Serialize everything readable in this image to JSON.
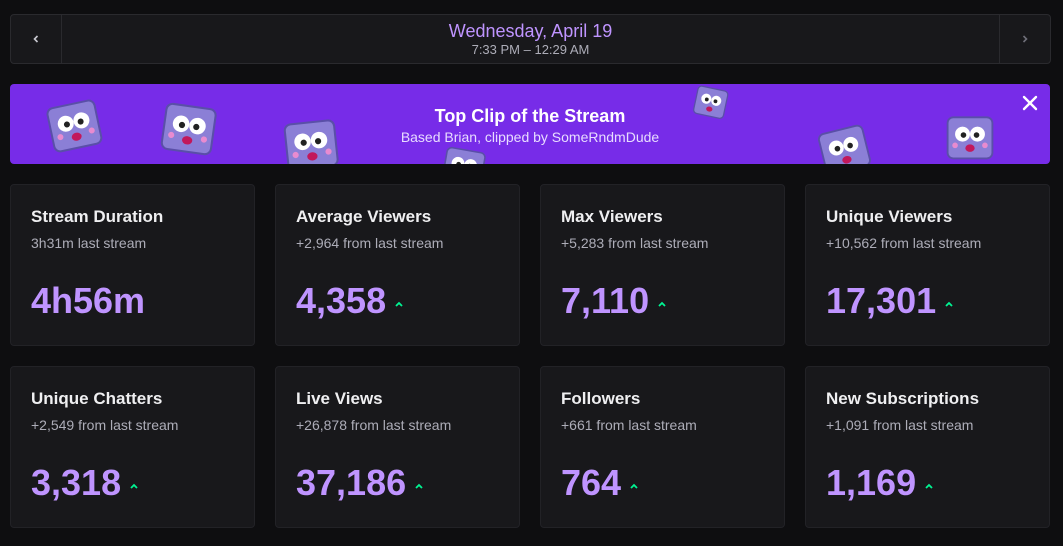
{
  "header": {
    "date": "Wednesday, April 19",
    "time_range": "7:33 PM – 12:29 AM"
  },
  "clip_banner": {
    "title": "Top Clip of the Stream",
    "subtitle": "Based Brian, clipped by SomeRndmDude"
  },
  "stats": [
    {
      "title": "Stream Duration",
      "sub": "3h31m last stream",
      "value": "4h56m",
      "trend": "none"
    },
    {
      "title": "Average Viewers",
      "sub": "+2,964 from last stream",
      "value": "4,358",
      "trend": "up"
    },
    {
      "title": "Max Viewers",
      "sub": "+5,283 from last stream",
      "value": "7,110",
      "trend": "up"
    },
    {
      "title": "Unique Viewers",
      "sub": "+10,562 from last stream",
      "value": "17,301",
      "trend": "up"
    },
    {
      "title": "Unique Chatters",
      "sub": "+2,549 from last stream",
      "value": "3,318",
      "trend": "up"
    },
    {
      "title": "Live Views",
      "sub": "+26,878 from last stream",
      "value": "37,186",
      "trend": "up"
    },
    {
      "title": "Followers",
      "sub": "+661 from last stream",
      "value": "764",
      "trend": "up"
    },
    {
      "title": "New Subscriptions",
      "sub": "+1,091 from last stream",
      "value": "1,169",
      "trend": "up"
    }
  ],
  "colors": {
    "accent": "#bf94ff",
    "banner": "#772ce8",
    "trend_up": "#00f593"
  },
  "icons": {
    "prev": "chevron-left-icon",
    "next": "chevron-right-icon",
    "close": "close-icon",
    "trend": "arrow-up-icon"
  }
}
